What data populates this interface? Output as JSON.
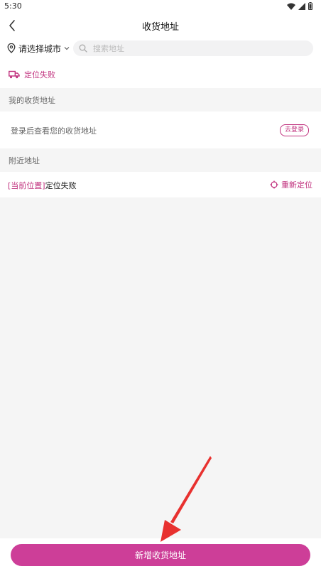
{
  "status_bar": {
    "time": "5:30"
  },
  "nav": {
    "title": "收货地址"
  },
  "search": {
    "city_label": "请选择城市",
    "placeholder": "搜索地址",
    "value": ""
  },
  "location_status": {
    "label": "定位失败"
  },
  "my_addresses": {
    "header": "我的收货地址",
    "login_prompt": "登录后查看您的收货地址",
    "login_button": "去登录"
  },
  "nearby": {
    "header": "附近地址",
    "current_tag": "[当前位置]",
    "current_status": "定位失败",
    "relocate_label": "重新定位"
  },
  "bottom": {
    "add_button": "新增收货地址"
  },
  "colors": {
    "accent": "#c0307d",
    "button": "#cd3e98",
    "annotation_arrow": "#e8312f"
  }
}
